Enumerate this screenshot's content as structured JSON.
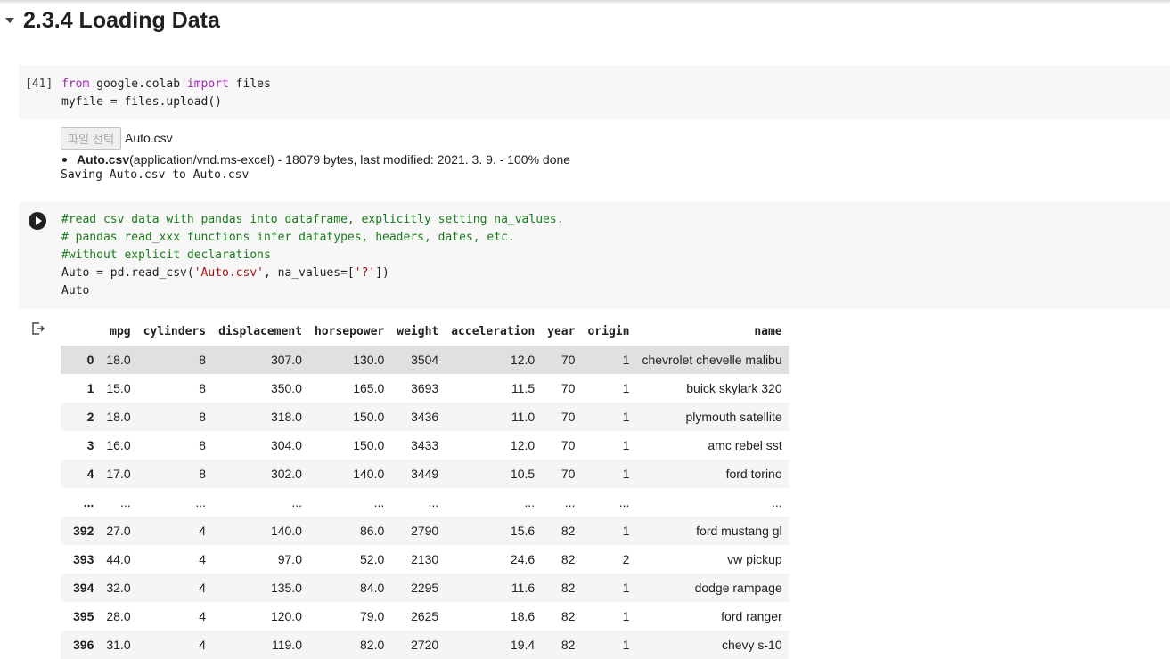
{
  "section": {
    "title": "2.3.4 Loading Data"
  },
  "cell1": {
    "exec_count": "[41]",
    "line1": {
      "kw_from": "from",
      "module": " google.colab ",
      "kw_import": "import",
      "rest": " files"
    },
    "line2": "myfile = files.upload()"
  },
  "output1": {
    "file_button": "파일 선택",
    "file_name": "Auto.csv",
    "upload_bold": "Auto.csv",
    "upload_detail": "(application/vnd.ms-excel) - 18079 bytes, last modified: 2021. 3. 9. - 100% done",
    "saving": "Saving Auto.csv to Auto.csv"
  },
  "cell2": {
    "comment1": "#read csv data with pandas into dataframe, explicitly setting na_values.",
    "comment2": "# pandas read_xxx functions infer datatypes, headers, dates, etc.",
    "comment3": "#without explicit declarations",
    "line4_a": "Auto = pd.read_csv(",
    "line4_str1": "'Auto.csv'",
    "line4_b": ", na_values=[",
    "line4_str2": "'?'",
    "line4_c": "])",
    "line5": "Auto"
  },
  "dataframe": {
    "columns": [
      "",
      "mpg",
      "cylinders",
      "displacement",
      "horsepower",
      "weight",
      "acceleration",
      "year",
      "origin",
      "name"
    ],
    "rows": [
      [
        "0",
        "18.0",
        "8",
        "307.0",
        "130.0",
        "3504",
        "12.0",
        "70",
        "1",
        "chevrolet chevelle malibu"
      ],
      [
        "1",
        "15.0",
        "8",
        "350.0",
        "165.0",
        "3693",
        "11.5",
        "70",
        "1",
        "buick skylark 320"
      ],
      [
        "2",
        "18.0",
        "8",
        "318.0",
        "150.0",
        "3436",
        "11.0",
        "70",
        "1",
        "plymouth satellite"
      ],
      [
        "3",
        "16.0",
        "8",
        "304.0",
        "150.0",
        "3433",
        "12.0",
        "70",
        "1",
        "amc rebel sst"
      ],
      [
        "4",
        "17.0",
        "8",
        "302.0",
        "140.0",
        "3449",
        "10.5",
        "70",
        "1",
        "ford torino"
      ],
      [
        "...",
        "...",
        "...",
        "...",
        "...",
        "...",
        "...",
        "...",
        "...",
        "..."
      ],
      [
        "392",
        "27.0",
        "4",
        "140.0",
        "86.0",
        "2790",
        "15.6",
        "82",
        "1",
        "ford mustang gl"
      ],
      [
        "393",
        "44.0",
        "4",
        "97.0",
        "52.0",
        "2130",
        "24.6",
        "82",
        "2",
        "vw pickup"
      ],
      [
        "394",
        "32.0",
        "4",
        "135.0",
        "84.0",
        "2295",
        "11.6",
        "82",
        "1",
        "dodge rampage"
      ],
      [
        "395",
        "28.0",
        "4",
        "120.0",
        "79.0",
        "2625",
        "18.6",
        "82",
        "1",
        "ford ranger"
      ],
      [
        "396",
        "31.0",
        "4",
        "119.0",
        "82.0",
        "2720",
        "19.4",
        "82",
        "1",
        "chevy s-10"
      ]
    ]
  }
}
